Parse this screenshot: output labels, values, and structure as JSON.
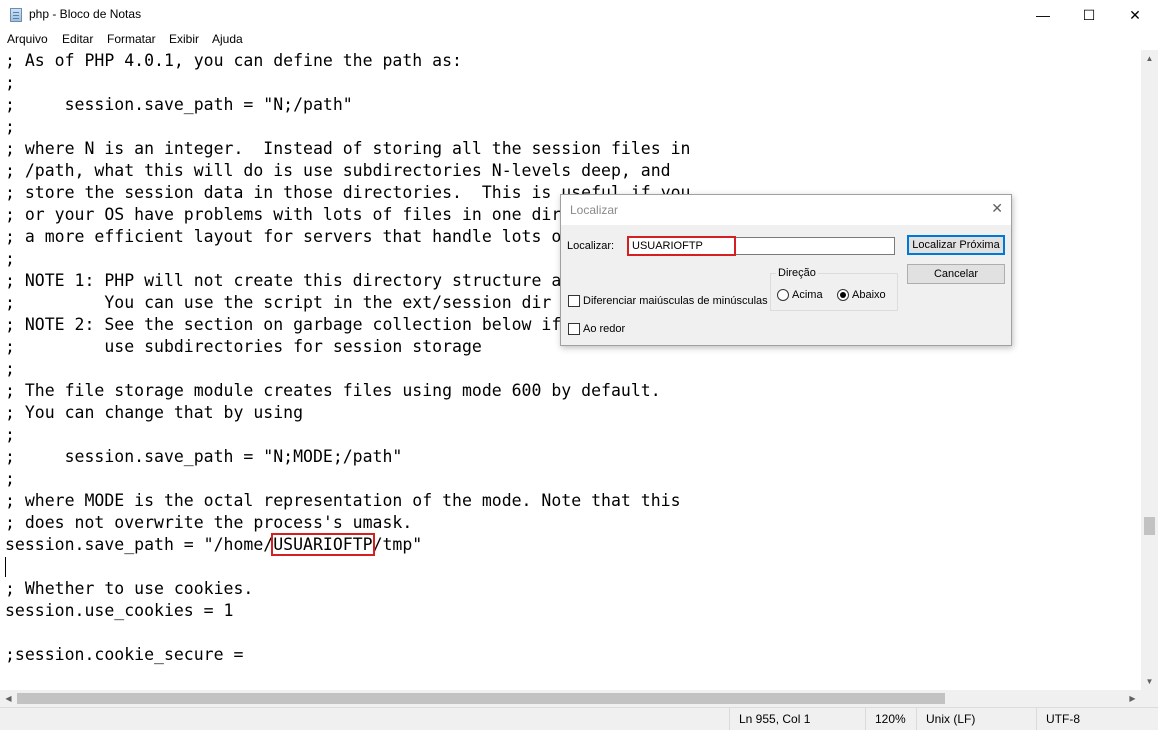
{
  "window": {
    "title": "php - Bloco de Notas",
    "minimize_glyph": "—",
    "maximize_glyph": "☐",
    "close_glyph": "✕"
  },
  "menu": [
    "Arquivo",
    "Editar",
    "Formatar",
    "Exibir",
    "Ajuda"
  ],
  "editor": {
    "lines": [
      "; As of PHP 4.0.1, you can define the path as:",
      ";",
      ";     session.save_path = \"N;/path\"",
      ";",
      "; where N is an integer.  Instead of storing all the session files in",
      "; /path, what this will do is use subdirectories N-levels deep, and",
      "; store the session data in those directories.  This is useful if you",
      "; or your OS have problems with lots of files in one directory, and is",
      "; a more efficient layout for servers that handle lots of sessions.",
      ";",
      "; NOTE 1: PHP will not create this directory structure automatically.",
      ";         You can use the script in the ext/session dir for that purpose.",
      "; NOTE 2: See the section on garbage collection below if you choose to",
      ";         use subdirectories for session storage",
      ";",
      "; The file storage module creates files using mode 600 by default.",
      "; You can change that by using",
      ";",
      ";     session.save_path = \"N;MODE;/path\"",
      ";",
      "; where MODE is the octal representation of the mode. Note that this",
      "; does not overwrite the process's umask."
    ],
    "save_path_prefix": "session.save_path = \"/home/",
    "save_path_match": "USUARIOFTP",
    "save_path_suffix": "/tmp\"",
    "line_blank": "",
    "line_cookies_comment": "; Whether to use cookies.",
    "line_use_cookies": "session.use_cookies = 1",
    "line_cookie_secure": ";session.cookie_secure ="
  },
  "find_dialog": {
    "title": "Localizar",
    "find_label": "Localizar:",
    "find_value": "USUARIOFTP",
    "find_next_label": "Localizar Próxima",
    "cancel_label": "Cancelar",
    "direction_label": "Direção",
    "up_label": "Acima",
    "down_label": "Abaixo",
    "selected_direction": "Abaixo",
    "match_case_label": "Diferenciar maiúsculas de minúsculas",
    "wrap_around_label": "Ao redor",
    "match_case_checked": false,
    "wrap_around_checked": false
  },
  "status_bar": {
    "position": "Ln 955, Col 1",
    "zoom": "120%",
    "line_ending": "Unix (LF)",
    "encoding": "UTF-8"
  },
  "colors": {
    "highlight_outline": "#d42020",
    "default_button_border": "#0078d7"
  }
}
